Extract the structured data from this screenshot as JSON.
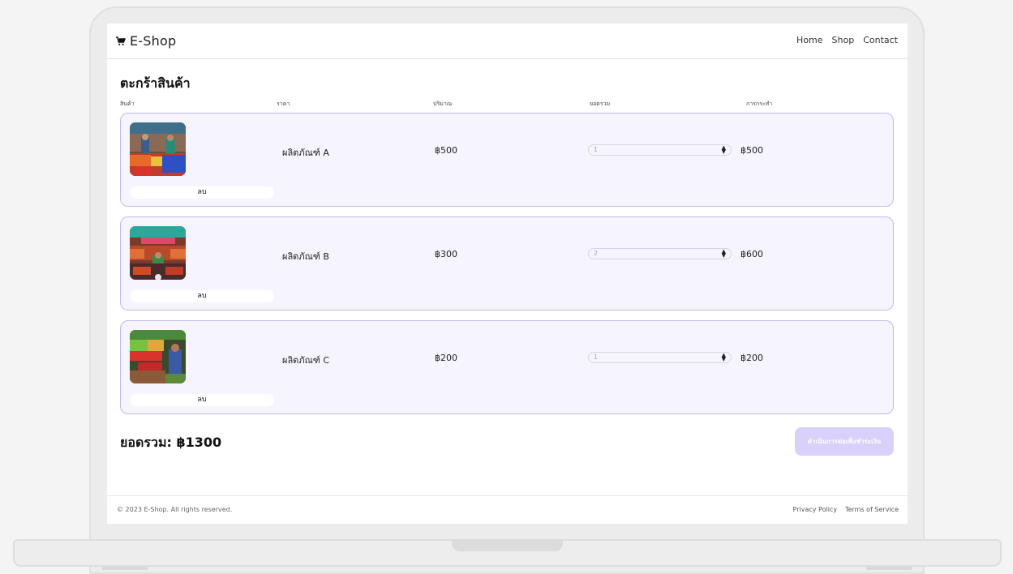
{
  "header": {
    "brand": "E-Shop",
    "nav": [
      "Home",
      "Shop",
      "Contact"
    ]
  },
  "cart": {
    "title": "ตะกร้าสินค้า",
    "columns": [
      "สินค้า",
      "ราคา",
      "ปริมาณ",
      "ยอดรวม",
      "การกระทำ"
    ],
    "remove_label": "ลบ",
    "items": [
      {
        "name": "ผลิตภัณฑ์ A",
        "price": "฿500",
        "quantity": "1",
        "total": "฿500"
      },
      {
        "name": "ผลิตภัณฑ์ B",
        "price": "฿300",
        "quantity": "2",
        "total": "฿600"
      },
      {
        "name": "ผลิตภัณฑ์ C",
        "price": "฿200",
        "quantity": "1",
        "total": "฿200"
      }
    ],
    "grand_total": "ยอดรวม: ฿1300",
    "checkout_label": "ดำเนินการต่อเพื่อชำระเงิน"
  },
  "footer": {
    "copyright": "© 2023 E-Shop. All rights reserved.",
    "links": [
      "Privacy Policy",
      "Terms of Service"
    ]
  },
  "colors": {
    "accent": "#d9d0fb",
    "card_bg": "#f6f4fe",
    "card_border": "#c4b9ee"
  }
}
